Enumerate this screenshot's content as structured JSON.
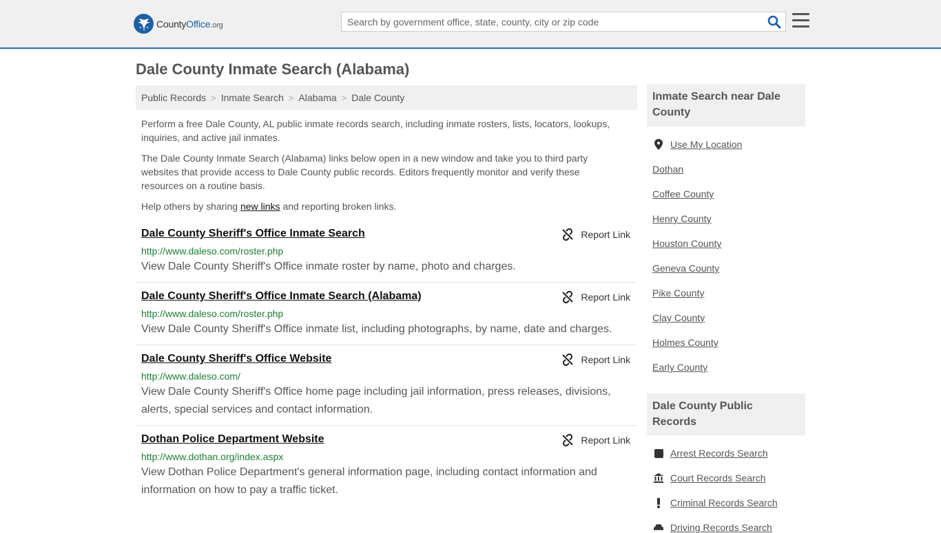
{
  "header": {
    "logo_main": "County",
    "logo_accent": "Office",
    "logo_tld": ".org",
    "search_placeholder": "Search by government office, state, county, city or zip code"
  },
  "page_title": "Dale County Inmate Search (Alabama)",
  "breadcrumb": [
    "Public Records",
    "Inmate Search",
    "Alabama",
    "Dale County"
  ],
  "intro": {
    "p1": "Perform a free Dale County, AL public inmate records search, including inmate rosters, lists, locators, lookups, inquiries, and active jail inmates.",
    "p2": "The Dale County Inmate Search (Alabama) links below open in a new window and take you to third party websites that provide access to Dale County public records. Editors frequently monitor and verify these resources on a routine basis.",
    "p3_before": "Help others by sharing ",
    "p3_link": "new links",
    "p3_after": " and reporting broken links."
  },
  "report_label": "Report Link",
  "results": [
    {
      "title": "Dale County Sheriff's Office Inmate Search",
      "url": "http://www.daleso.com/roster.php",
      "desc": "View Dale County Sheriff's Office inmate roster by name, photo and charges."
    },
    {
      "title": "Dale County Sheriff's Office Inmate Search (Alabama)",
      "url": "http://www.daleso.com/roster.php",
      "desc": "View Dale County Sheriff's Office inmate list, including photographs, by name, date and charges."
    },
    {
      "title": "Dale County Sheriff's Office Website",
      "url": "http://www.daleso.com/",
      "desc": "View Dale County Sheriff's Office home page including jail information, press releases, divisions, alerts, special services and contact information."
    },
    {
      "title": "Dothan Police Department Website",
      "url": "http://www.dothan.org/index.aspx",
      "desc": "View Dothan Police Department's general information page, including contact information and information on how to pay a traffic ticket."
    }
  ],
  "sidebar": {
    "nearby_title": "Inmate Search near Dale County",
    "use_location": "Use My Location",
    "nearby": [
      "Dothan",
      "Coffee County",
      "Henry County",
      "Houston County",
      "Geneva County",
      "Pike County",
      "Clay County",
      "Holmes County",
      "Early County"
    ],
    "records_title": "Dale County Public Records",
    "records": [
      {
        "label": "Arrest Records Search",
        "icon": "square-icon"
      },
      {
        "label": "Court Records Search",
        "icon": "courthouse-icon"
      },
      {
        "label": "Criminal Records Search",
        "icon": "exclamation-icon"
      },
      {
        "label": "Driving Records Search",
        "icon": "car-icon"
      }
    ]
  },
  "colors": {
    "brand": "#1f5fa6",
    "url_green": "#1e7e34",
    "header_bg": "#f0f0f0"
  }
}
